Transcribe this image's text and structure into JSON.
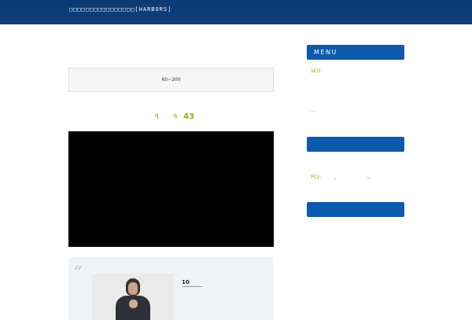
{
  "header": {
    "site_title": "□□□□□□□□□□□□□□□□[HARBORS]"
  },
  "main": {
    "ad_text": "60~200",
    "counter": {
      "glyph_left": "ꟼ",
      "glyph_right": "ꟼ",
      "number": "43"
    },
    "quote": {
      "mark": "“",
      "rank_number": "10"
    }
  },
  "sidebar": {
    "menu_title": "MENU",
    "link_seo": "SEO",
    "link_ellipsis": "...",
    "link_pc2": "PC2,",
    "text_comma": ",",
    "text_ellipsis": "..."
  },
  "colors": {
    "header_bg": "#0e3f7b",
    "accent_green": "#86b300",
    "widget_blue": "#0d5aac"
  }
}
